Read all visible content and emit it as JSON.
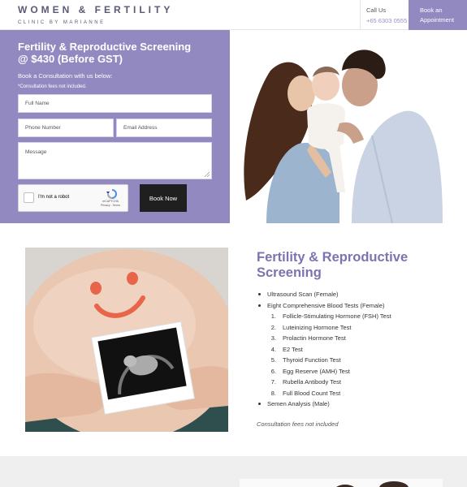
{
  "header": {
    "logo_main": "WOMEN & FERTILITY",
    "logo_sub": "CLINIC BY MARIANNE",
    "contact_label": "Call Us",
    "contact_phone": "+65 6303 0555",
    "book_label_1": "Book an",
    "book_label_2": "Appointment"
  },
  "hero": {
    "title_line1": "Fertility & Reproductive Screening",
    "title_line2": "@ $430 (Before GST)",
    "subtitle": "Book a Consultation with us below:",
    "note": "*Consultation fees not included.",
    "form": {
      "full_name_placeholder": "Full Name",
      "phone_placeholder": "Phone Number",
      "email_placeholder": "Email Address",
      "message_placeholder": "Message",
      "captcha_label": "I'm not a robot",
      "captcha_brand": "reCAPTCHA",
      "captcha_links": "Privacy - Terms",
      "submit_label": "Book Now"
    }
  },
  "screening": {
    "title_line1": "Fertility & Reproductive",
    "title_line2": "Screening",
    "items": {
      "b1": "Ultrasound Scan (Female)",
      "b2": "Eight Comprehensive Blood Tests (Female)",
      "n1": "Follicle-Stimulating Hormone (FSH) Test",
      "n2": "Luteinizing Hormone Test",
      "n3": "Prolactin Hormone Test",
      "n4": "E2 Test",
      "n5": "Thyroid Function Test",
      "n6": "Egg Reserve (AMH) Test",
      "n7": "Rubella Antibody Test",
      "n8": "Full Blood Count Test",
      "b3": "Semen Analysis (Male)"
    },
    "numbers": [
      "1.",
      "2.",
      "3.",
      "4.",
      "5.",
      "6.",
      "7.",
      "8."
    ],
    "note": "Consultation fees not included"
  },
  "colors": {
    "accent": "#9389c1",
    "title": "#7d73b1",
    "button_dark": "#1f1f1f"
  }
}
